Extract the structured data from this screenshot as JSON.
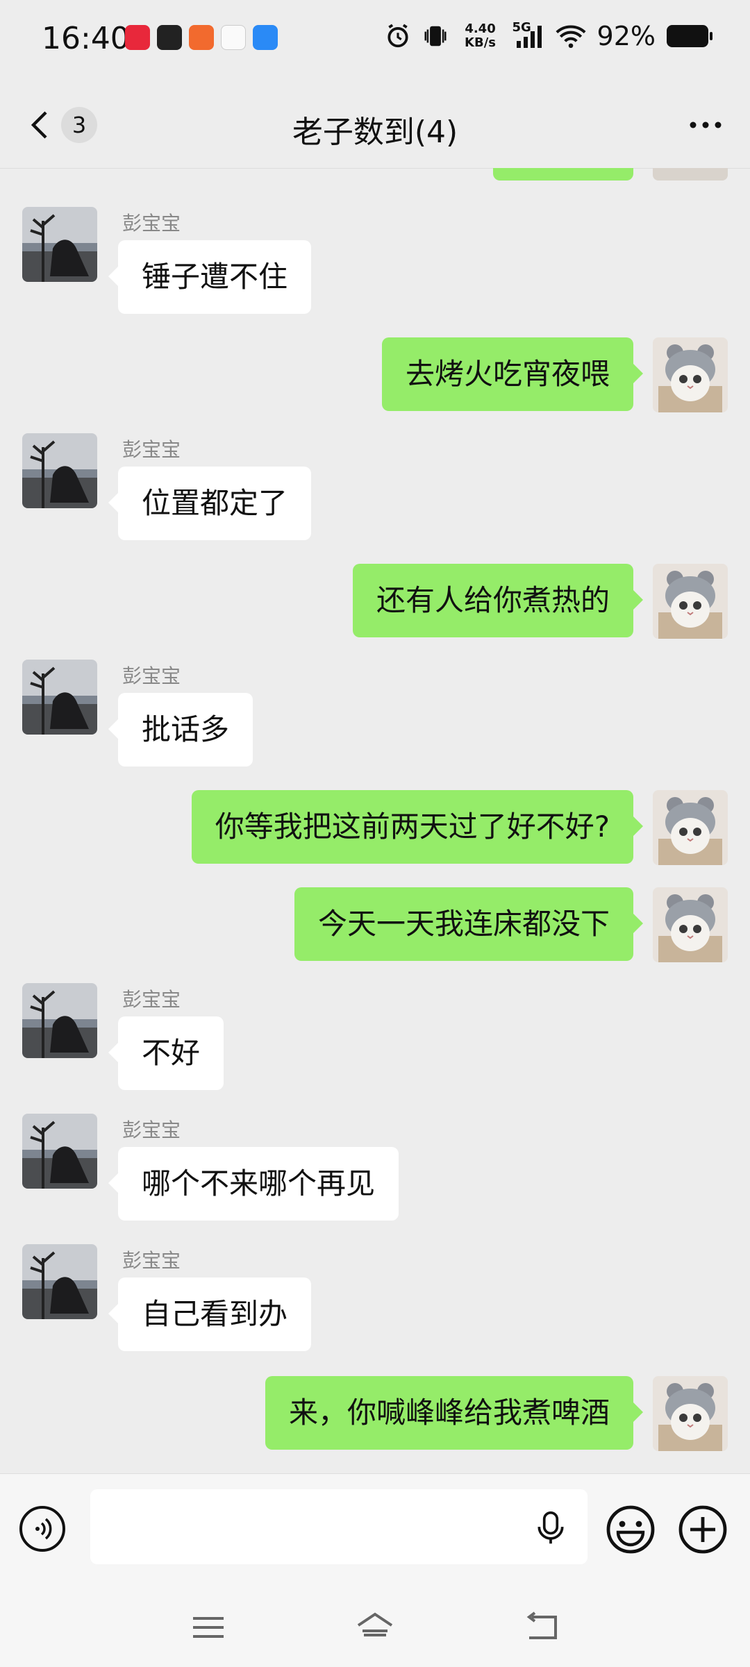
{
  "status_bar": {
    "time": "16:40",
    "net_speed": "4.40 KB/s",
    "network": "5G",
    "battery": "92%"
  },
  "header": {
    "back_count": "3",
    "title": "老子数到(4)"
  },
  "messages": [
    {
      "side": "in",
      "sender": "彭宝宝",
      "text": "锤子遭不住"
    },
    {
      "side": "out",
      "text": "去烤火吃宵夜喂"
    },
    {
      "side": "in",
      "sender": "彭宝宝",
      "text": "位置都定了"
    },
    {
      "side": "out",
      "text": "还有人给你煮热的"
    },
    {
      "side": "in",
      "sender": "彭宝宝",
      "text": "批话多"
    },
    {
      "side": "out",
      "text": "你等我把这前两天过了好不好?"
    },
    {
      "side": "out",
      "text": "今天一天我连床都没下"
    },
    {
      "side": "in",
      "sender": "彭宝宝",
      "text": "不好"
    },
    {
      "side": "in",
      "sender": "彭宝宝",
      "text": "哪个不来哪个再见"
    },
    {
      "side": "in",
      "sender": "彭宝宝",
      "text": "自己看到办"
    },
    {
      "side": "out",
      "text": "来，你喊峰峰给我煮啤酒"
    }
  ],
  "icons": {
    "back": "chevron-left-icon",
    "more": "more-dots-icon",
    "voice": "voice-icon",
    "mic": "microphone-icon",
    "emoji": "emoji-icon",
    "plus": "plus-icon",
    "nav_menu": "menu-icon",
    "nav_home": "home-icon",
    "nav_back": "back-icon"
  },
  "colors": {
    "background": "#ededed",
    "outgoing_bubble": "#95ec69",
    "incoming_bubble": "#ffffff"
  }
}
